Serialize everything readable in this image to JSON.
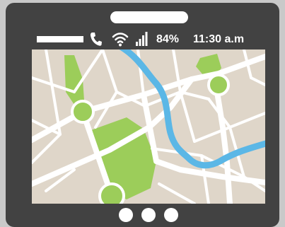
{
  "status_bar": {
    "battery": "84%",
    "time": "11:30 a.m",
    "icons": [
      "phone-icon",
      "wifi-icon",
      "signal-bars-icon"
    ]
  },
  "map": {
    "type": "street-map",
    "colors": {
      "background": "#dfd6c9",
      "roads": "#ffffff",
      "river": "#5bb7e6",
      "parks": "#9ccd5a",
      "device_body": "#424242"
    }
  },
  "nav_buttons": [
    "dot",
    "dot",
    "dot"
  ]
}
